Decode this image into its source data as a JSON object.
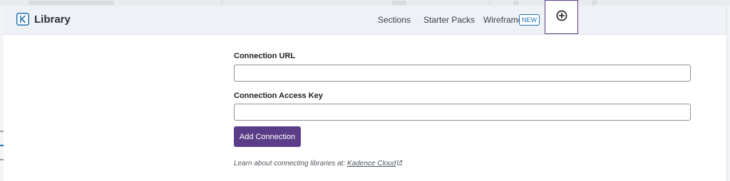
{
  "header": {
    "app_title": "Library",
    "logo_icon": "kadence-logo-icon",
    "nav": [
      {
        "label": "Sections"
      },
      {
        "label": "Starter Packs"
      },
      {
        "label": "Wireframe",
        "badge": "NEW"
      }
    ],
    "add_icon": "plus-circle-icon"
  },
  "form": {
    "url_label": "Connection URL",
    "url_value": "",
    "key_label": "Connection Access Key",
    "key_value": "",
    "submit_label": "Add Connection",
    "help_text": "Learn about connecting libraries at: ",
    "help_link": "Kadence Cloud",
    "help_link_icon": "external-link-icon"
  },
  "colors": {
    "accent": "#5b3c88",
    "badge": "#2271b1",
    "header_bg": "#eef1f5"
  }
}
